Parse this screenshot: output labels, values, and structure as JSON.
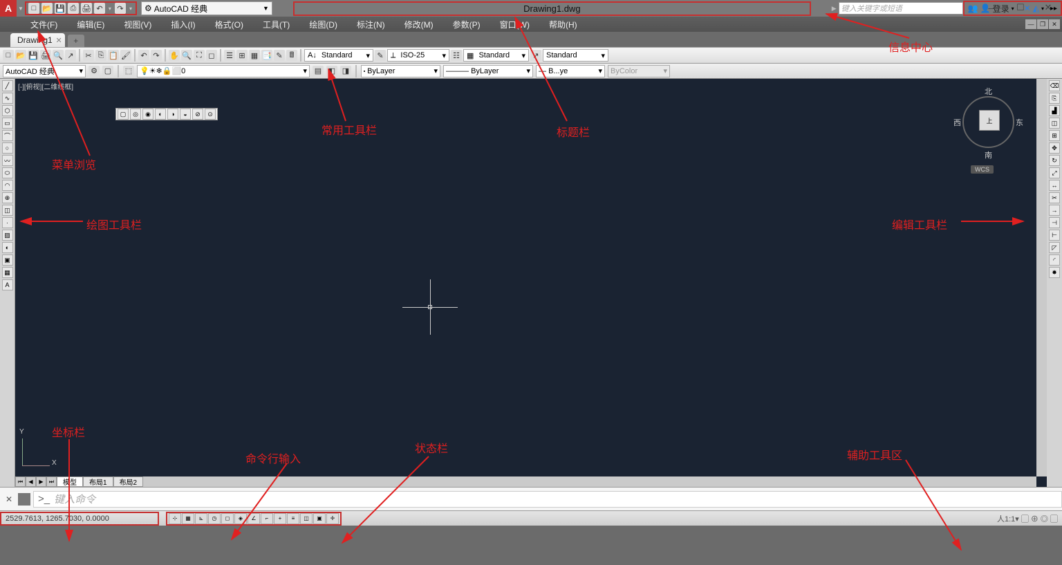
{
  "app": {
    "title": "Drawing1.dwg",
    "workspace": "AutoCAD 经典",
    "login": "登录"
  },
  "search_placeholder": "键入关键字或短语",
  "menu": [
    "文件(F)",
    "编辑(E)",
    "视图(V)",
    "插入(I)",
    "格式(O)",
    "工具(T)",
    "绘图(D)",
    "标注(N)",
    "修改(M)",
    "参数(P)",
    "窗口(W)",
    "帮助(H)"
  ],
  "doc_tab": "Drawing1",
  "styles": {
    "text": "Standard",
    "dim": "ISO-25",
    "table": "Standard",
    "ml": "Standard"
  },
  "workspace2": "AutoCAD 经典",
  "layer": "0",
  "props": {
    "color": "ByLayer",
    "ltype": "ByLayer",
    "lweight": "B...ye",
    "pstyle": "ByColor"
  },
  "viewport": "[-][俯视][二维线框]",
  "viewcube": {
    "n": "北",
    "s": "南",
    "e": "东",
    "w": "西",
    "top": "上"
  },
  "wcs": "WCS",
  "ucs": {
    "x": "X",
    "y": "Y"
  },
  "layout_tabs": [
    "模型",
    "布局1",
    "布局2"
  ],
  "cmd_prompt": ">_",
  "cmd_placeholder": "键入命令",
  "coords": "2529.7613, 1265.7030, 0.0000",
  "status_right": "人1:1▾ ▢ ⊕ ◎ ▢",
  "annotations": {
    "title": "标题栏",
    "info": "信息中心",
    "qat": "常用工具栏",
    "menu": "菜单浏览",
    "draw": "绘图工具栏",
    "edit": "编辑工具栏",
    "coords": "坐标栏",
    "cmd": "命令行输入",
    "status": "状态栏",
    "aux": "辅助工具区"
  }
}
